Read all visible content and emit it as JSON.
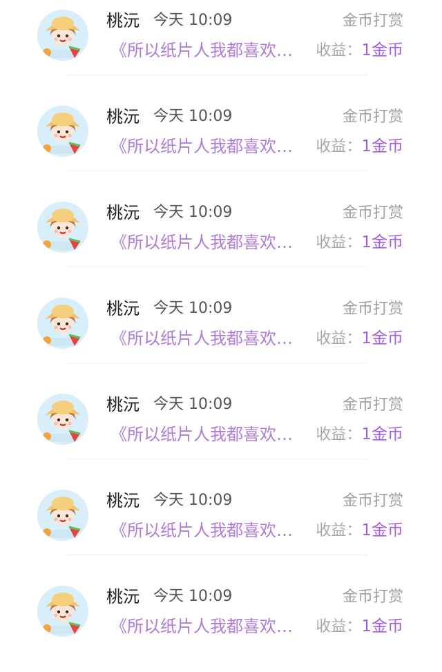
{
  "items": [
    {
      "name": "桃沅",
      "time": "今天 10:09",
      "type": "金币打赏",
      "title": "《所以纸片人我都喜欢…",
      "income_label": "收益：",
      "income_value": "1金币"
    },
    {
      "name": "桃沅",
      "time": "今天 10:09",
      "type": "金币打赏",
      "title": "《所以纸片人我都喜欢…",
      "income_label": "收益：",
      "income_value": "1金币"
    },
    {
      "name": "桃沅",
      "time": "今天 10:09",
      "type": "金币打赏",
      "title": "《所以纸片人我都喜欢…",
      "income_label": "收益：",
      "income_value": "1金币"
    },
    {
      "name": "桃沅",
      "time": "今天 10:09",
      "type": "金币打赏",
      "title": "《所以纸片人我都喜欢…",
      "income_label": "收益：",
      "income_value": "1金币"
    },
    {
      "name": "桃沅",
      "time": "今天 10:09",
      "type": "金币打赏",
      "title": "《所以纸片人我都喜欢…",
      "income_label": "收益：",
      "income_value": "1金币"
    },
    {
      "name": "桃沅",
      "time": "今天 10:09",
      "type": "金币打赏",
      "title": "《所以纸片人我都喜欢…",
      "income_label": "收益：",
      "income_value": "1金币"
    },
    {
      "name": "桃沅",
      "time": "今天 10:09",
      "type": "金币打赏",
      "title": "《所以纸片人我都喜欢…",
      "income_label": "收益：",
      "income_value": "1金币"
    }
  ],
  "avatar": {
    "icon": "girl-with-watermelon-avatar-icon"
  },
  "colors": {
    "title": "#b07bd6",
    "income_value": "#a45be0",
    "muted": "#a0a0a0",
    "name": "#1f1f1f"
  }
}
